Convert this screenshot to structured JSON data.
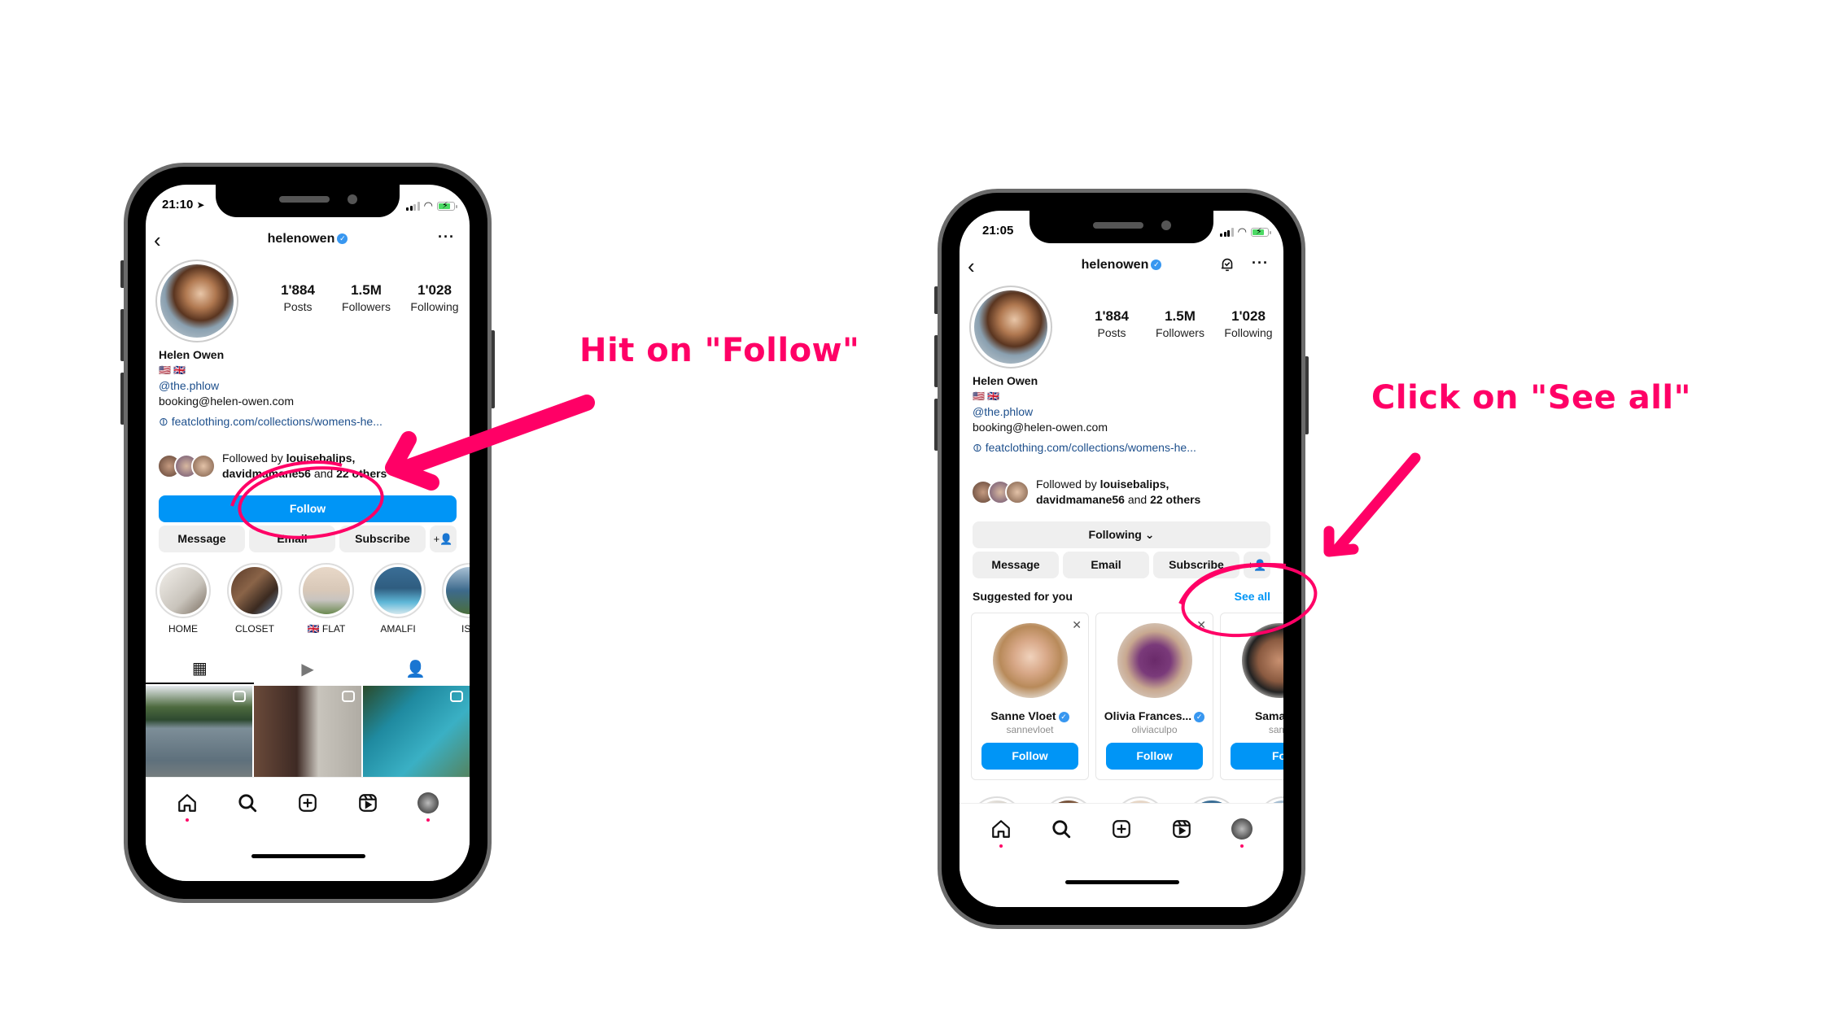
{
  "accent_color": "#ff0066",
  "annotations": {
    "left_caption": "Hit on \"Follow\"",
    "right_caption": "Click on \"See all\""
  },
  "left_phone": {
    "status": {
      "time": "21:10",
      "location_icon": "location-arrow-icon"
    },
    "nav": {
      "username": "helenowen",
      "verified": "✓",
      "more": "···",
      "back": "‹"
    },
    "stats": [
      {
        "value": "1'884",
        "label": "Posts"
      },
      {
        "value": "1.5M",
        "label": "Followers"
      },
      {
        "value": "1'028",
        "label": "Following"
      }
    ],
    "bio": {
      "name": "Helen Owen",
      "flags": "🇺🇸 🇬🇧",
      "handle": "@the.phlow",
      "email": "booking@helen-owen.com",
      "link": "featclothing.com/collections/womens-he..."
    },
    "followed_by": {
      "prefix": "Followed by ",
      "user1": "louisebalips,",
      "user2": "davidmamane56",
      "mid": " and ",
      "others": "22 others"
    },
    "buttons": {
      "follow": "Follow",
      "message": "Message",
      "email": "Email",
      "subscribe": "Subscribe",
      "add_person": "+👤"
    },
    "highlights": [
      {
        "label": "HOME"
      },
      {
        "label": "CLOSET"
      },
      {
        "label": "🇬🇧 FLAT"
      },
      {
        "label": "AMALFI"
      },
      {
        "label": "ISC"
      }
    ]
  },
  "right_phone": {
    "status": {
      "time": "21:05"
    },
    "nav": {
      "username": "helenowen",
      "verified": "✓",
      "more": "···",
      "back": "‹"
    },
    "stats": [
      {
        "value": "1'884",
        "label": "Posts"
      },
      {
        "value": "1.5M",
        "label": "Followers"
      },
      {
        "value": "1'028",
        "label": "Following"
      }
    ],
    "bio": {
      "name": "Helen Owen",
      "flags": "🇺🇸 🇬🇧",
      "handle": "@the.phlow",
      "email": "booking@helen-owen.com",
      "link": "featclothing.com/collections/womens-he..."
    },
    "followed_by": {
      "prefix": "Followed by ",
      "user1": "louisebalips,",
      "user2": "davidmamane56",
      "mid": " and ",
      "others": "22 others"
    },
    "buttons": {
      "following": "Following ⌄",
      "message": "Message",
      "email": "Email",
      "subscribe": "Subscribe",
      "add_person": "+👤"
    },
    "suggested": {
      "title": "Suggested for you",
      "see_all": "See all",
      "cards": [
        {
          "name": "Sanne Vloet",
          "handle": "sannevloet",
          "verified": true,
          "button": "Follow"
        },
        {
          "name": "Olivia Frances...",
          "handle": "oliviaculpo",
          "verified": true,
          "button": "Follow"
        },
        {
          "name": "Samanth",
          "handle": "sami",
          "verified": false,
          "button": "Fo"
        }
      ]
    }
  }
}
